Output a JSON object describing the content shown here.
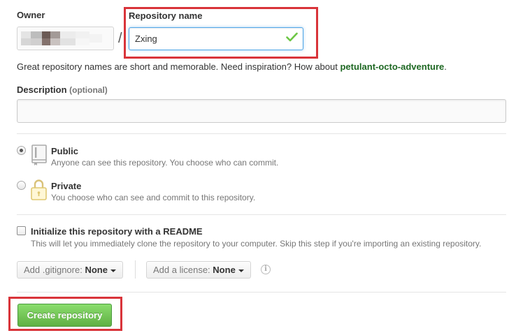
{
  "owner": {
    "label": "Owner"
  },
  "separator": "/",
  "repository": {
    "label": "Repository name",
    "value": "Zxing",
    "status_icon": "check-icon"
  },
  "tip": {
    "text": "Great repository names are short and memorable. Need inspiration? How about ",
    "suggestion": "petulant-octo-adventure",
    "suffix": "."
  },
  "description": {
    "label": "Description",
    "optional": "(optional)",
    "value": ""
  },
  "visibility": {
    "selected": "public",
    "options": [
      {
        "title": "Public",
        "note": "Anyone can see this repository. You choose who can commit.",
        "icon": "book-icon"
      },
      {
        "title": "Private",
        "note": "You choose who can see and commit to this repository.",
        "icon": "lock-icon"
      }
    ]
  },
  "readme": {
    "label": "Initialize this repository with a README",
    "note": "This will let you immediately clone the repository to your computer. Skip this step if you're importing an existing repository.",
    "checked": false
  },
  "gitignore": {
    "prefix": "Add .gitignore:",
    "value": "None"
  },
  "license": {
    "prefix": "Add a license:",
    "value": "None"
  },
  "create_button": {
    "label": "Create repository"
  },
  "colors": {
    "highlight": "#d9343a",
    "create_button": "#60b044",
    "suggestion_link": "#1e6823",
    "check": "#6cc644",
    "input_focus": "#51a7e8"
  }
}
